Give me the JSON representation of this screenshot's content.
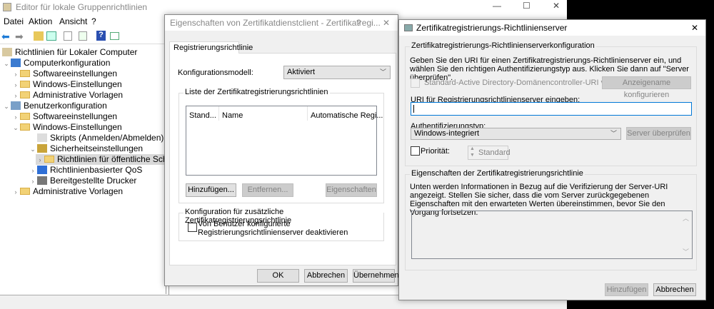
{
  "editor": {
    "title": "Editor für lokale Gruppenrichtlinien",
    "menu": [
      "Datei",
      "Aktion",
      "Ansicht",
      "?"
    ],
    "tree": [
      {
        "label": "Richtlinien für Lokaler Computer",
        "level": 0,
        "chev": "",
        "icon": "policy"
      },
      {
        "label": "Computerkonfiguration",
        "level": 0,
        "chev": "v",
        "icon": "computer"
      },
      {
        "label": "Softwareeinstellungen",
        "level": 1,
        "chev": ">",
        "icon": "folder"
      },
      {
        "label": "Windows-Einstellungen",
        "level": 1,
        "chev": ">",
        "icon": "folder"
      },
      {
        "label": "Administrative Vorlagen",
        "level": 1,
        "chev": ">",
        "icon": "folder"
      },
      {
        "label": "Benutzerkonfiguration",
        "level": 0,
        "chev": "v",
        "icon": "user"
      },
      {
        "label": "Softwareeinstellungen",
        "level": 1,
        "chev": ">",
        "icon": "folder"
      },
      {
        "label": "Windows-Einstellungen",
        "level": 1,
        "chev": "v",
        "icon": "folder"
      },
      {
        "label": "Skripts (Anmelden/Abmelden)",
        "level": 2,
        "chev": "",
        "icon": "script"
      },
      {
        "label": "Sicherheitseinstellungen",
        "level": 2,
        "chev": "v",
        "icon": "security"
      },
      {
        "label": "Richtlinien für öffentliche Schlüsse",
        "level": 3,
        "chev": ">",
        "icon": "folder",
        "selected": true
      },
      {
        "label": "Richtlinienbasierter QoS",
        "level": 2,
        "chev": ">",
        "icon": "chart"
      },
      {
        "label": "Bereitgestellte Drucker",
        "level": 2,
        "chev": ">",
        "icon": "printer"
      },
      {
        "label": "Administrative Vorlagen",
        "level": 1,
        "chev": ">",
        "icon": "folder"
      }
    ]
  },
  "dialog1": {
    "title": "Eigenschaften von Zertifikatdienstclient - Zertifikatregi...",
    "help": "?",
    "close": "✕",
    "tab": "Registrierungsrichtlinie",
    "model_label": "Konfigurationsmodell:",
    "model_value": "Aktiviert",
    "list_group": "Liste der Zertifikatregistrierungsrichtlinien",
    "columns": [
      "Stand...",
      "Name",
      "Automatische Regi..."
    ],
    "add": "Hinzufügen...",
    "remove": "Entfernen...",
    "props": "Eigenschaften",
    "extra_group": "Konfiguration für zusätzliche Zertifikatregistrierungsrichtlinie",
    "checkbox": "Von Benutzer konfigurierte Registrierungsrichtlinienserver deaktivieren",
    "ok": "OK",
    "cancel": "Abbrechen",
    "apply": "Übernehmen"
  },
  "dialog2": {
    "title": "Zertifikatregistrierungs-Richtlinienserver",
    "close": "✕",
    "group1": "Zertifikatregistrierungs-Richtlinienserverkonfiguration",
    "desc1": "Geben Sie den URI für einen Zertifikatregistrierungs-Richtlinienserver ein, und wählen Sie den richtigen Authentifizierungstyp aus. Klicken Sie dann auf \"Server überprüfen\".",
    "default_ad": "Standard-Active Directory-Domänencontroller-URI verwenden",
    "config_name": "Anzeigename konfigurieren",
    "uri_label": "URI für Registrierungsrichtlinienserver eingeben:",
    "uri_value": "",
    "auth_label": "Authentifizierungstyp:",
    "auth_value": "Windows-integriert",
    "verify": "Server überprüfen",
    "priority": "Priorität:",
    "priority_value": "Standard",
    "group2": "Eigenschaften der Zertifikatregistrierungsrichtlinie",
    "desc2": "Unten werden Informationen in Bezug auf die Verifizierung der Server-URI angezeigt. Stellen Sie sicher, dass die vom Server zurückgegebenen Eigenschaften mit den erwarteten Werten übereinstimmen, bevor Sie den Vorgang fortsetzen.",
    "add": "Hinzufügen",
    "cancel": "Abbrechen"
  }
}
